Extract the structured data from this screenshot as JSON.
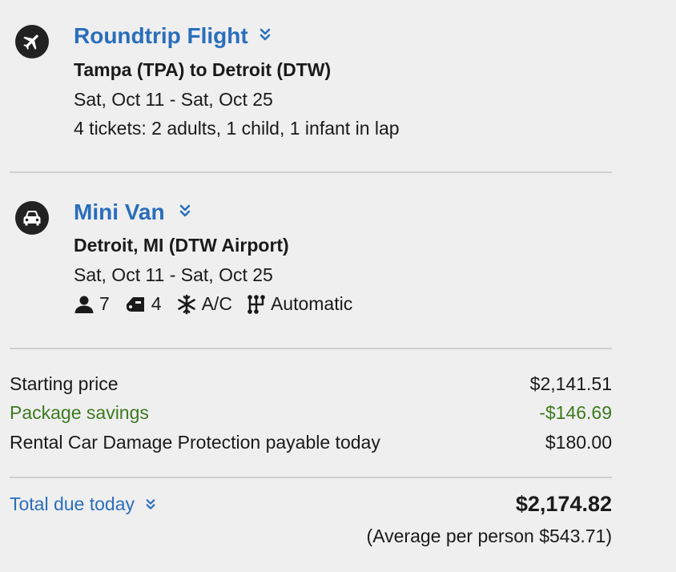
{
  "flight": {
    "title": "Roundtrip Flight",
    "route": "Tampa (TPA) to Detroit (DTW)",
    "dates": "Sat, Oct 11 - Sat, Oct 25",
    "tickets": "4 tickets: 2 adults, 1 child, 1 infant in lap",
    "icon": "airplane-icon"
  },
  "car": {
    "title": "Mini Van",
    "location": "Detroit, MI (DTW Airport)",
    "dates": "Sat, Oct 11 - Sat, Oct 25",
    "icon": "car-icon",
    "features": {
      "passengers": "7",
      "bags": "4",
      "ac": "A/C",
      "transmission": "Automatic"
    }
  },
  "pricing": {
    "starting_label": "Starting price",
    "starting_value": "$2,141.51",
    "savings_label": "Package savings",
    "savings_value": "-$146.69",
    "protection_label": "Rental Car Damage Protection payable today",
    "protection_value": "$180.00",
    "total_label": "Total due today",
    "total_value": "$2,174.82",
    "average": "(Average per person $543.71)"
  },
  "colors": {
    "link": "#2a6ebb",
    "savings": "#3d7a1f",
    "icon_bg": "#222222",
    "background": "#efeff0"
  }
}
